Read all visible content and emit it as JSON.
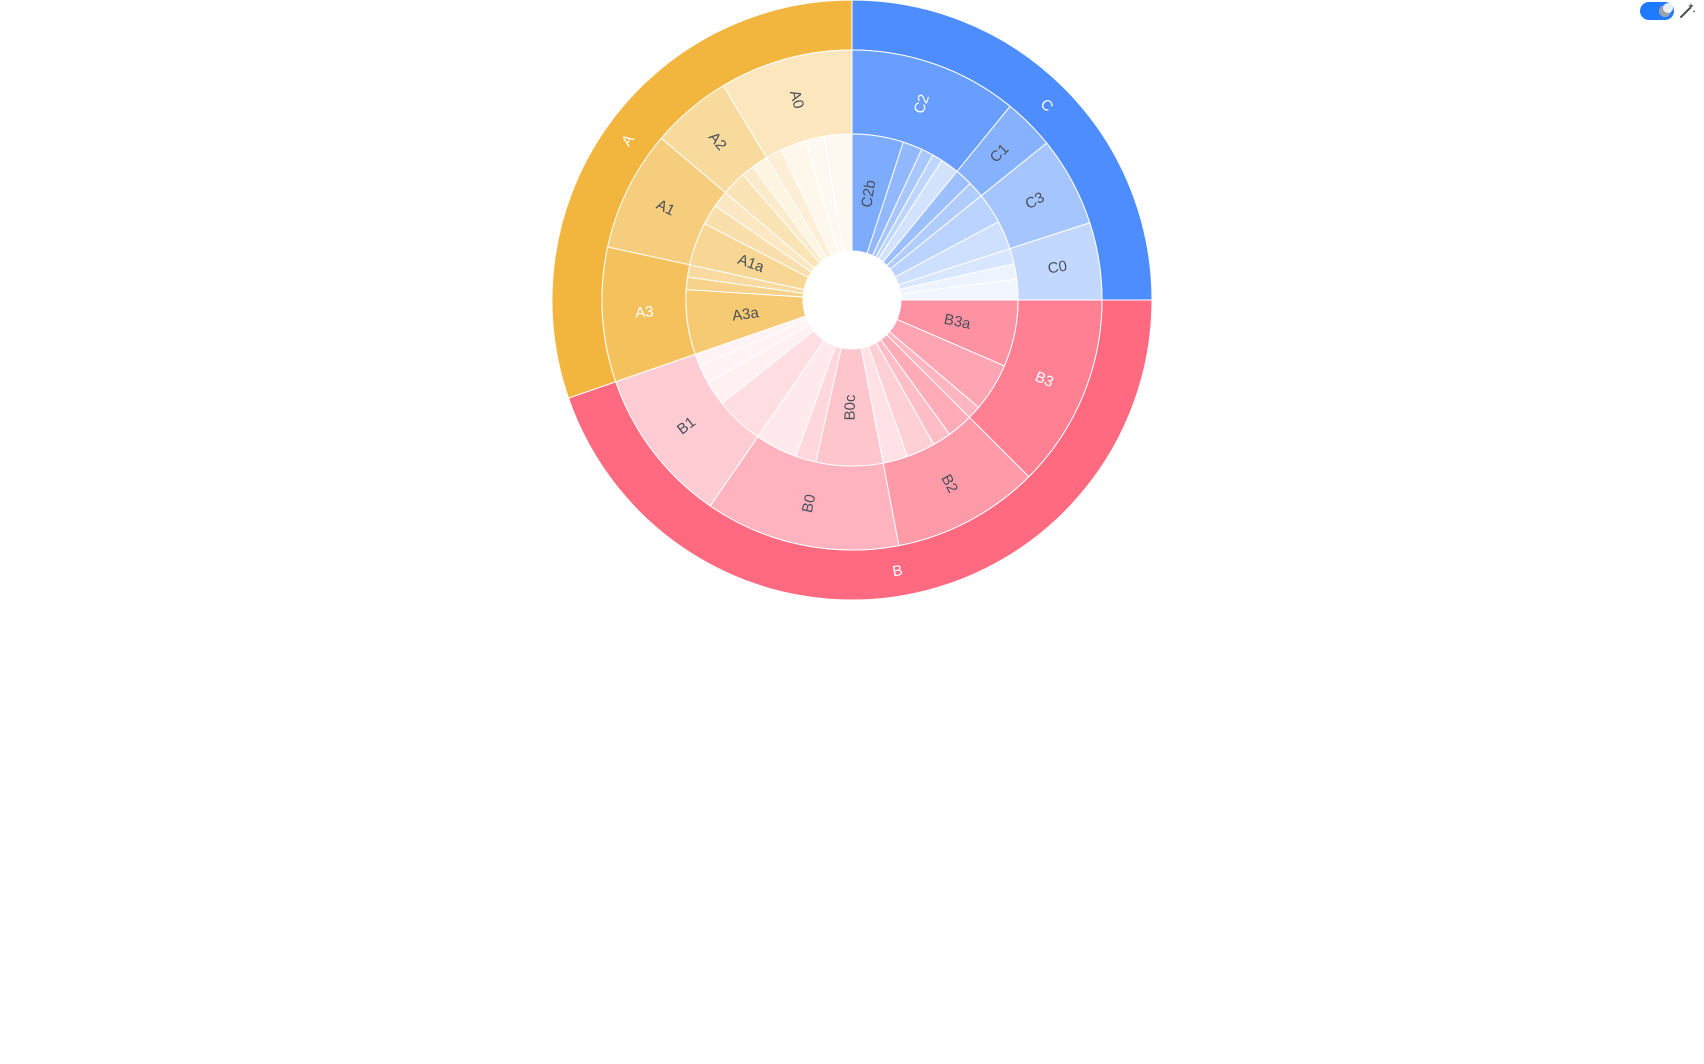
{
  "toolbar": {
    "theme_toggle_icon": "moon-icon",
    "wand_icon": "magic-wand-icon",
    "toggle_color": "#1e7bff"
  },
  "chart_data": {
    "type": "sunburst",
    "rings": 3,
    "colors": {
      "A": "#f2b63f",
      "B": "#ff6a80",
      "C": "#4d8dff"
    },
    "nodes": [
      {
        "name": "C",
        "value": 25,
        "children": [
          {
            "name": "C2",
            "value": 10.9,
            "children": [
              {
                "name": "C2b",
                "value": 5.0
              },
              {
                "name": "",
                "value": 1.9
              },
              {
                "name": "",
                "value": 1.2
              },
              {
                "name": "",
                "value": 1.0
              },
              {
                "name": "",
                "value": 1.8
              }
            ]
          },
          {
            "name": "C1",
            "value": 3.3,
            "children": [
              {
                "name": "",
                "value": 1.7
              },
              {
                "name": "",
                "value": 1.6
              }
            ]
          },
          {
            "name": "C3",
            "value": 5.8,
            "children": [
              {
                "name": "",
                "value": 3.0
              },
              {
                "name": "",
                "value": 2.8
              }
            ]
          },
          {
            "name": "C0",
            "value": 5.0,
            "children": [
              {
                "name": "",
                "value": 1.5
              },
              {
                "name": "",
                "value": 1.5
              },
              {
                "name": "",
                "value": 2.0
              }
            ]
          }
        ]
      },
      {
        "name": "B",
        "value": 44.7,
        "children": [
          {
            "name": "B3",
            "value": 12.5,
            "children": [
              {
                "name": "B3a",
                "value": 6.5
              },
              {
                "name": "",
                "value": 4.7
              },
              {
                "name": "",
                "value": 1.3
              }
            ]
          },
          {
            "name": "B2",
            "value": 9.5,
            "children": [
              {
                "name": "",
                "value": 2.5
              },
              {
                "name": "",
                "value": 1.8
              },
              {
                "name": "",
                "value": 2.8
              },
              {
                "name": "",
                "value": 2.4
              }
            ]
          },
          {
            "name": "B0",
            "value": 12.6,
            "children": [
              {
                "name": "B0c",
                "value": 6.5
              },
              {
                "name": "",
                "value": 2.0
              },
              {
                "name": "",
                "value": 4.1
              }
            ]
          },
          {
            "name": "B1",
            "value": 10.1,
            "children": [
              {
                "name": "",
                "value": 4.7
              },
              {
                "name": "",
                "value": 2.4
              },
              {
                "name": "",
                "value": 1.8
              },
              {
                "name": "",
                "value": 1.2
              }
            ]
          }
        ]
      },
      {
        "name": "A",
        "value": 30.3,
        "children": [
          {
            "name": "A3",
            "value": 8.7,
            "children": [
              {
                "name": "A3a",
                "value": 6.3
              },
              {
                "name": "",
                "value": 1.2
              },
              {
                "name": "",
                "value": 1.2
              }
            ]
          },
          {
            "name": "A1",
            "value": 7.8,
            "children": [
              {
                "name": "A1a",
                "value": 4.2
              },
              {
                "name": "",
                "value": 2.0
              },
              {
                "name": "",
                "value": 1.6
              }
            ]
          },
          {
            "name": "A2",
            "value": 5.2,
            "children": [
              {
                "name": "",
                "value": 2.4
              },
              {
                "name": "",
                "value": 1.2
              },
              {
                "name": "",
                "value": 1.6
              }
            ]
          },
          {
            "name": "A0",
            "value": 8.6,
            "children": [
              {
                "name": "",
                "value": 1.6
              },
              {
                "name": "",
                "value": 2.5
              },
              {
                "name": "",
                "value": 1.8
              },
              {
                "name": "",
                "value": 2.7
              }
            ]
          }
        ]
      }
    ]
  }
}
